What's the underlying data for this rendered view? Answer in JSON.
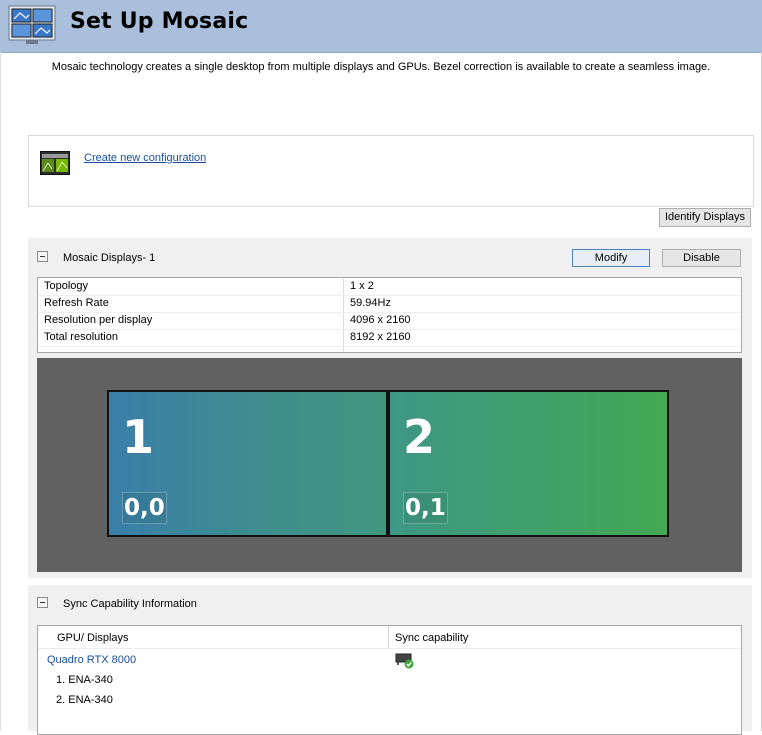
{
  "header": {
    "title": "Set Up Mosaic",
    "icon": "mosaic-displays-icon"
  },
  "description": "Mosaic technology creates a single desktop from multiple displays and GPUs. Bezel correction is available to create a seamless image.",
  "config": {
    "icon": "mosaic-config-icon",
    "create_link": "Create new configuration"
  },
  "identify_button": "Identify Displays",
  "mosaic": {
    "heading": "Mosaic Displays- 1",
    "modify_button": "Modify",
    "disable_button": "Disable",
    "properties": [
      {
        "key": "Topology",
        "value": "1 x 2"
      },
      {
        "key": "Refresh Rate",
        "value": "59.94Hz"
      },
      {
        "key": "Resolution per display",
        "value": "4096 x 2160"
      },
      {
        "key": "Total resolution",
        "value": "8192 x 2160"
      }
    ],
    "displays": [
      {
        "number": "1",
        "coord": "0,0"
      },
      {
        "number": "2",
        "coord": "0,1"
      }
    ]
  },
  "sync": {
    "heading": "Sync Capability Information",
    "col_gpu": "GPU/ Displays",
    "col_sync": "Sync capability",
    "gpu": "Quadro RTX 8000",
    "sync_icon": "sync-ok-icon",
    "displays": [
      "1. ENA-340",
      "2. ENA-340"
    ]
  },
  "colors": {
    "header_bg": "#a9bfdc",
    "link": "#1a4f9c",
    "section_bg": "#f0f0f0",
    "canvas_bg": "#616161"
  }
}
